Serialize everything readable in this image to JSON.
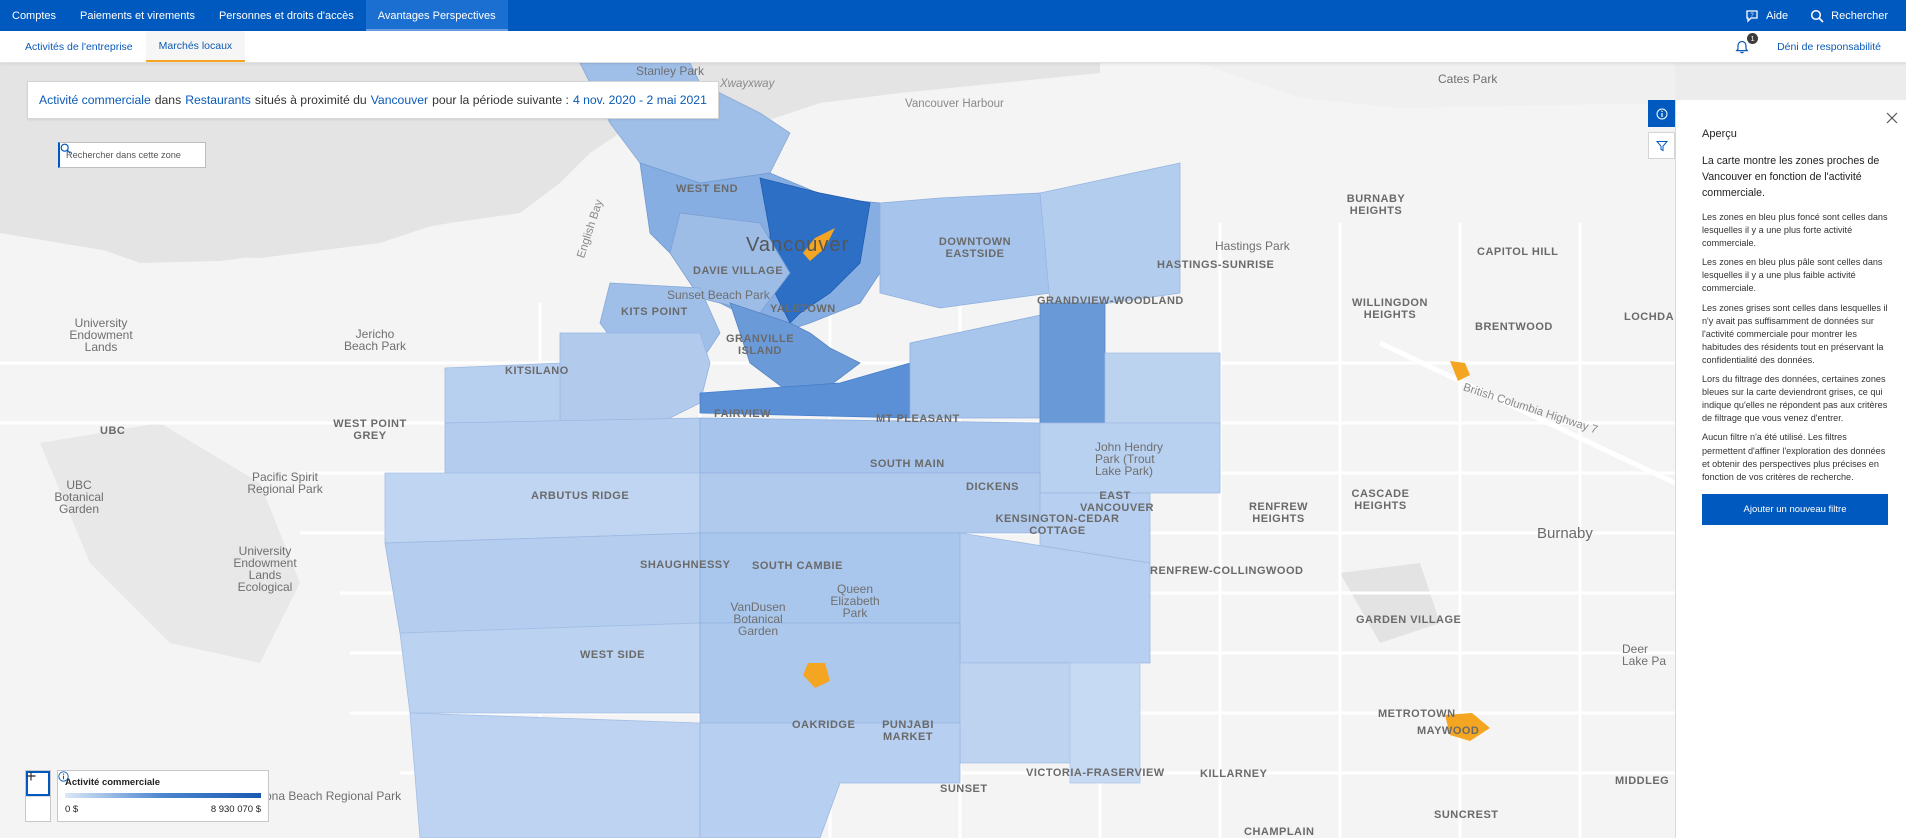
{
  "topnav": {
    "tabs": [
      {
        "label": "Comptes"
      },
      {
        "label": "Paiements et virements"
      },
      {
        "label": "Personnes et droits d'accès"
      },
      {
        "label": "Avantages Perspectives"
      }
    ],
    "help_label": "Aide",
    "search_label": "Rechercher"
  },
  "subnav": {
    "tabs": [
      {
        "label": "Activités de l'entreprise"
      },
      {
        "label": "Marchés locaux"
      }
    ],
    "notification_count": "1",
    "disclaimer_label": "Déni de responsabilité"
  },
  "summary": {
    "metric": "Activité commerciale",
    "word_in": "dans",
    "category": "Restaurants",
    "word_near": "situés à proximité du",
    "location": "Vancouver",
    "word_period": "pour la période suivante :",
    "period": "4 nov. 2020 - 2 mai 2021"
  },
  "zone_search": {
    "placeholder": "Rechercher dans cette zone"
  },
  "legend": {
    "title": "Activité commerciale",
    "min": "0 $",
    "max": "8 930 070 $"
  },
  "map_labels": {
    "vancouver": "Vancouver",
    "west_end": "WEST END",
    "davie_village": "DAVIE VILLAGE",
    "yaletown": "YALETOWN",
    "kits_point": "KITS POINT",
    "sunset_beach_park": "Sunset Beach Park",
    "granville_island": "GRANVILLE ISLAND",
    "kitsilano": "KITSILANO",
    "fairview": "FAIRVIEW",
    "mt_pleasant": "MT PLEASANT",
    "south_main": "SOUTH MAIN",
    "arbutus_ridge": "ARBUTUS RIDGE",
    "dickens": "DICKENS",
    "east_vancouver": "EAST VANCOUVER",
    "kensington_cedar_cottage": "KENSINGTON-CEDAR COTTAGE",
    "shaughnessy": "SHAUGHNESSY",
    "south_cambie": "SOUTH CAMBIE",
    "queen_elizabeth_park": "Queen Elizabeth Park",
    "vandusen": "VanDusen Botanical Garden",
    "west_side": "WEST SIDE",
    "oakridge": "OAKRIDGE",
    "punjabi_market": "PUNJABI MARKET",
    "victoria_fraserview": "VICTORIA-FRASERVIEW",
    "killarney": "KILLARNEY",
    "sunset": "SUNSET",
    "downtown_eastside": "DOWNTOWN EASTSIDE",
    "grandview_woodland": "GRANDVIEW-WOODLAND",
    "hastings_sunrise": "HASTINGS-SUNRISE",
    "hastings_park": "Hastings Park",
    "burnaby_heights": "BURNABY HEIGHTS",
    "capitol_hill": "CAPITOL HILL",
    "willingdon_heights": "WILLINGDON HEIGHTS",
    "brentwood": "BRENTWOOD",
    "renfrew_heights": "RENFREW HEIGHTS",
    "cascade_heights": "CASCADE HEIGHTS",
    "renfrew_collingwood": "RENFREW-COLLINGWOOD",
    "burnaby": "Burnaby",
    "garden_village": "GARDEN VILLAGE",
    "metrotown": "METROTOWN",
    "maywood": "MAYWOOD",
    "middlegate": "MIDDLEG",
    "suncrest": "SUNCREST",
    "champlain": "CHAMPLAIN",
    "cates_park": "Cates Park",
    "stanley_park": "Stanley Park",
    "xwayxway": "Xwayxway",
    "vancouver_harbour": "Vancouver Harbour",
    "english_bay": "English Bay",
    "jericho_beach_park": "Jericho Beach Park",
    "university_endowment_lands": "University Endowment Lands",
    "ubc": "UBC",
    "west_point_grey": "WEST POINT GREY",
    "pacific_spirit": "Pacific Spirit Regional Park",
    "ubc_botanical": "UBC Botanical Garden",
    "university_endowment_ecological": "University Endowment Lands Ecological",
    "john_hendry_park": "John Hendry Park (Trout Lake Park)",
    "lochdale": "LOCHDA",
    "deer_lake": "Deer Lake Pa",
    "beach_regional_park": "ona Beach Regional Park",
    "british_columbia_highway": "British Columbia Highway 7"
  },
  "panel": {
    "title": "Aperçu",
    "lead": "La carte montre les zones proches de Vancouver en fonction de l'activité commerciale.",
    "paragraphs": [
      "Les zones en bleu plus foncé sont celles dans lesquelles il y a une plus forte activité commerciale.",
      "Les zones en bleu plus pâle sont celles dans lesquelles il y a une plus faible activité commerciale.",
      "Les zones grises sont celles dans lesquelles il n'y avait pas suffisamment de données sur l'activité commerciale pour montrer les habitudes des résidents tout en préservant la confidentialité des données.",
      "Lors du filtrage des données, certaines zones bleues sur la carte deviendront grises, ce qui indique qu'elles ne répondent pas aux critères de filtrage que vous venez d'entrer.",
      "Aucun filtre n'a été utilisé. Les filtres permettent d'affiner l'exploration des données et obtenir des perspectives plus précises en fonction de vos critères de recherche."
    ],
    "add_filter_label": "Ajouter un nouveau filtre"
  },
  "colors": {
    "brand_blue": "#0059bf",
    "accent_orange": "#f4a623",
    "zone_light": "#bcd3ef",
    "zone_mid": "#86aee2",
    "zone_dark": "#3a78c9"
  }
}
